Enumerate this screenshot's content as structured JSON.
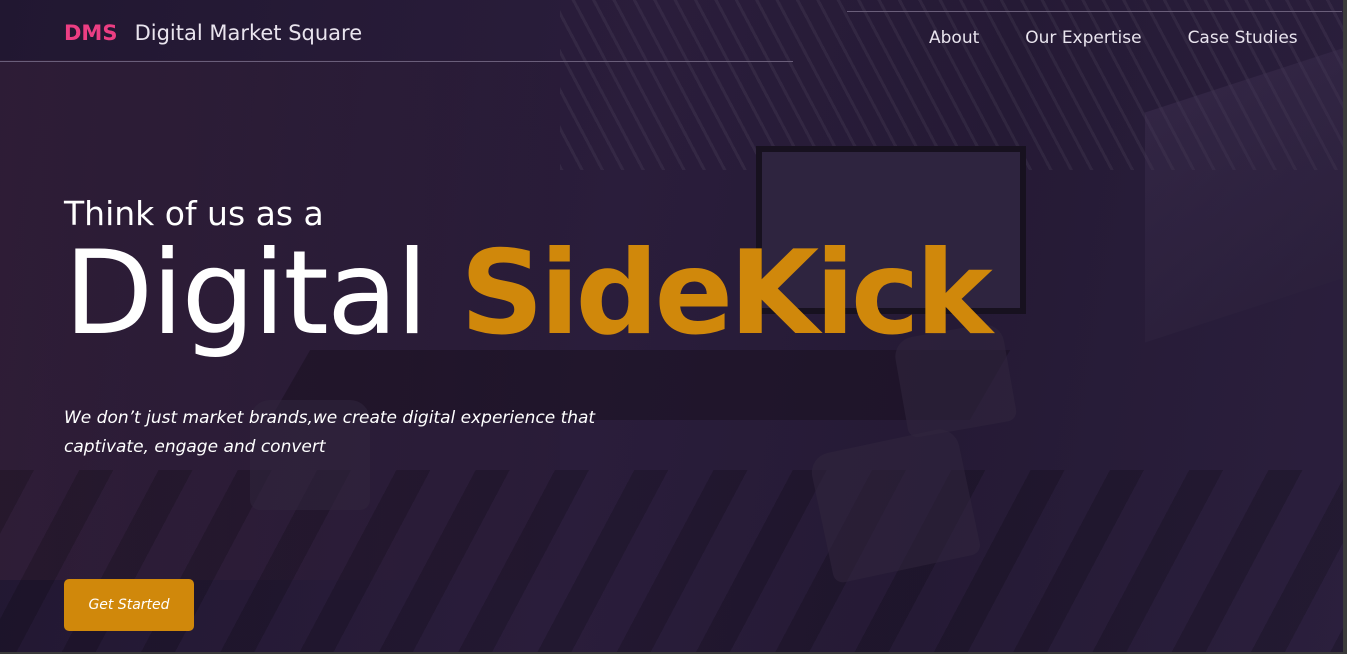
{
  "brand": {
    "abbr": "DMS",
    "name": "Digital Market Square",
    "abbr_color": "#ec3e83"
  },
  "nav": {
    "items": [
      {
        "label": "About"
      },
      {
        "label": "Our Expertise"
      },
      {
        "label": "Case Studies"
      }
    ]
  },
  "hero": {
    "eyebrow": "Think of us as a",
    "headline_light": "Digital",
    "headline_bold": "SideKick",
    "tagline": "We don’t just market brands,we create digital experience that captivate, engage and convert",
    "cta_label": "Get Started",
    "accent_color": "#d0880b",
    "background_image": "conference-room-photo"
  }
}
